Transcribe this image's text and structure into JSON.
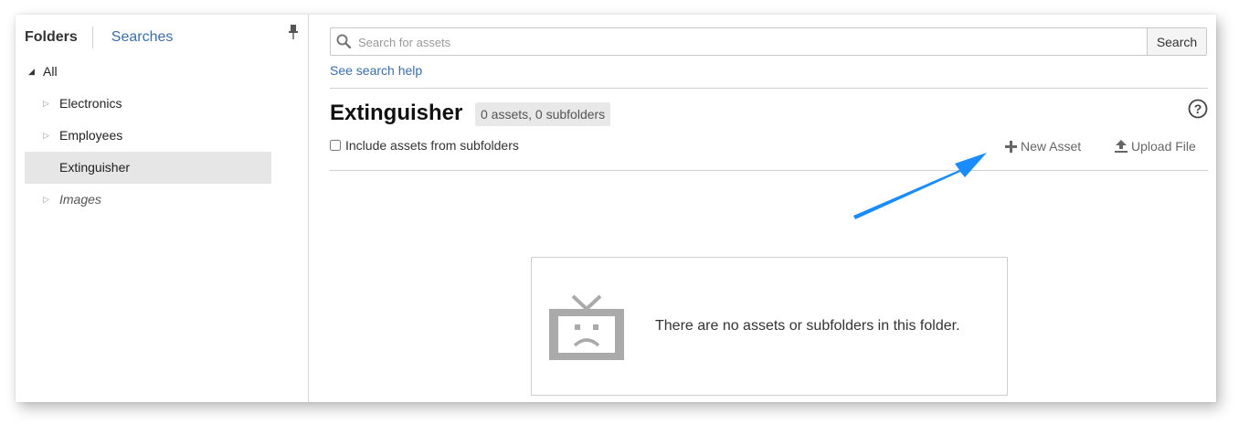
{
  "sidebar": {
    "tab_folders": "Folders",
    "tab_searches": "Searches",
    "tree": {
      "root": "All",
      "items": [
        "Electronics",
        "Employees",
        "Extinguisher",
        "Images"
      ]
    }
  },
  "search": {
    "placeholder": "Search for assets",
    "button": "Search",
    "help_link": "See search help"
  },
  "folder": {
    "title": "Extinguisher",
    "count": "0 assets, 0 subfolders",
    "include_label": "Include assets from subfolders",
    "include_checked": false
  },
  "actions": {
    "new_asset": "New Asset",
    "upload_file": "Upload File"
  },
  "empty": {
    "message": "There are no assets or subfolders in this folder."
  },
  "colors": {
    "link": "#3b6fa8",
    "annotation_arrow": "#1a8cff",
    "selected_row": "#e6e6e6"
  },
  "icons": [
    "pin-icon",
    "search-icon",
    "help-icon",
    "plus-icon",
    "upload-icon",
    "sad-tv-icon",
    "arrow-annotation"
  ]
}
